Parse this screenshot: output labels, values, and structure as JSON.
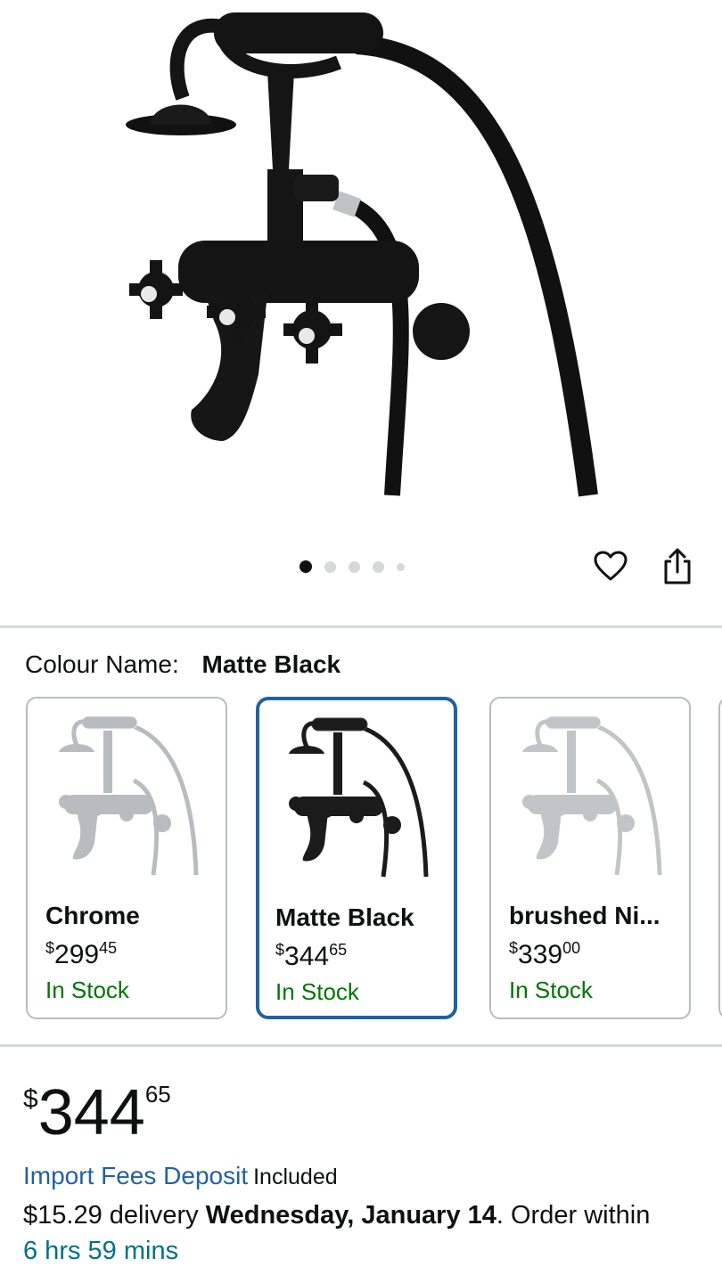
{
  "gallery": {
    "image_count": 5,
    "active_index": 0,
    "icons": {
      "wishlist": "heart-outline-icon",
      "share": "share-upload-icon"
    }
  },
  "colour": {
    "label": "Colour Name:",
    "selected": "Matte Black"
  },
  "variants": [
    {
      "name": "Chrome",
      "currency": "$",
      "price_whole": "299",
      "price_cents": "45",
      "stock": "In Stock",
      "finish_color": "#b8bcc0",
      "selected": false
    },
    {
      "name": "Matte Black",
      "currency": "$",
      "price_whole": "344",
      "price_cents": "65",
      "stock": "In Stock",
      "finish_color": "#1b1b1b",
      "selected": true
    },
    {
      "name": "brushed Ni...",
      "currency": "$",
      "price_whole": "339",
      "price_cents": "00",
      "stock": "In Stock",
      "finish_color": "#c2c5c8",
      "selected": false
    }
  ],
  "price": {
    "currency": "$",
    "whole": "344",
    "cents": "65"
  },
  "import_fees": {
    "link": "Import Fees Deposit",
    "suffix": "Included"
  },
  "delivery": {
    "prefix": "$15.29 delivery",
    "date": "Wednesday, January 14",
    "suffix": ". Order within",
    "countdown": "6 hrs 59 mins"
  },
  "colors": {
    "link": "#2162a1",
    "stock_green": "#007600",
    "countdown_teal": "#007185",
    "selected_border": "#2162a1"
  }
}
